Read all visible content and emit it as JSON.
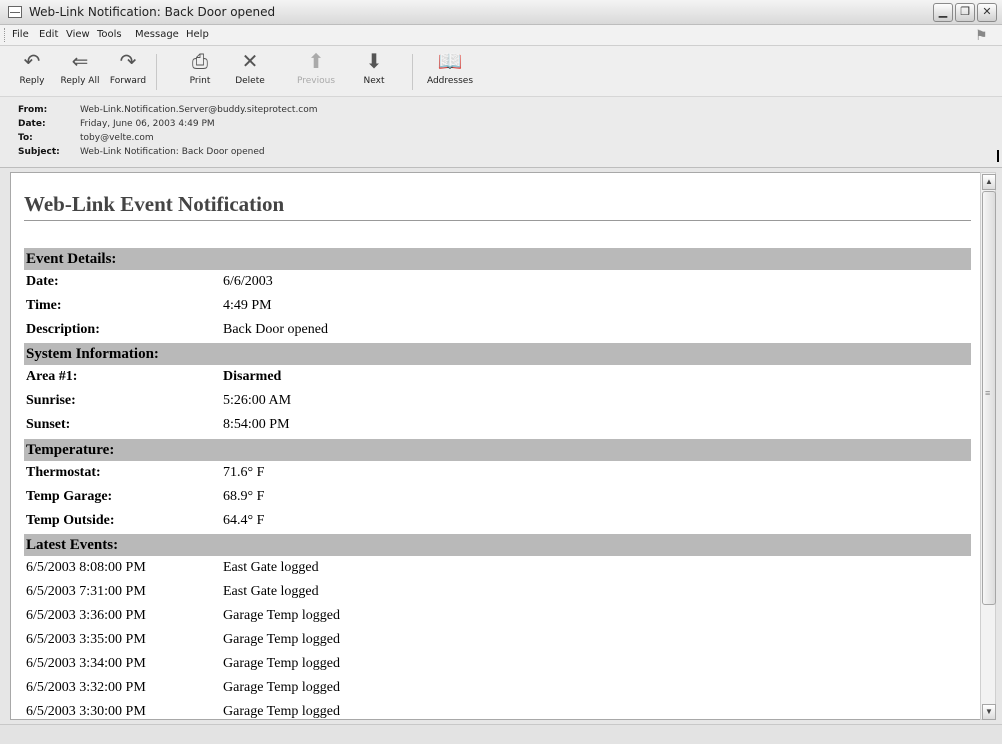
{
  "window": {
    "title": "Web-Link Notification: Back Door opened"
  },
  "menu": [
    "File",
    "Edit",
    "View",
    "Tools",
    "Message",
    "Help"
  ],
  "toolbar": {
    "reply": "Reply",
    "reply_all": "Reply All",
    "forward": "Forward",
    "print": "Print",
    "delete": "Delete",
    "previous": "Previous",
    "next": "Next",
    "addresses": "Addresses"
  },
  "header": {
    "from_label": "From:",
    "from": "Web-Link.Notification.Server@buddy.siteprotect.com",
    "date_label": "Date:",
    "date": "Friday, June 06, 2003 4:49 PM",
    "to_label": "To:",
    "to": "toby@velte.com",
    "subject_label": "Subject:",
    "subject": "Web-Link Notification: Back Door opened"
  },
  "message": {
    "title": "Web-Link Event Notification",
    "event_details": {
      "heading": "Event Details:",
      "rows": [
        {
          "k": "Date:",
          "v": "6/6/2003"
        },
        {
          "k": "Time:",
          "v": "4:49 PM"
        },
        {
          "k": "Description:",
          "v": "Back Door opened"
        }
      ]
    },
    "system_info": {
      "heading": "System Information:",
      "rows": [
        {
          "k": "Area #1:",
          "v": "Disarmed"
        },
        {
          "k": "Sunrise:",
          "v": "5:26:00 AM"
        },
        {
          "k": "Sunset:",
          "v": "8:54:00 PM"
        }
      ]
    },
    "temperature": {
      "heading": "Temperature:",
      "rows": [
        {
          "k": "Thermostat:",
          "v": "71.6° F"
        },
        {
          "k": "Temp Garage:",
          "v": "68.9° F"
        },
        {
          "k": "Temp Outside:",
          "v": "64.4° F"
        }
      ]
    },
    "latest_events": {
      "heading": "Latest Events:",
      "rows": [
        {
          "k": "6/5/2003 8:08:00 PM",
          "v": "East Gate logged"
        },
        {
          "k": "6/5/2003 7:31:00 PM",
          "v": "East Gate logged"
        },
        {
          "k": "6/5/2003 3:36:00 PM",
          "v": "Garage Temp logged"
        },
        {
          "k": "6/5/2003 3:35:00 PM",
          "v": "Garage Temp logged"
        },
        {
          "k": "6/5/2003 3:34:00 PM",
          "v": "Garage Temp logged"
        },
        {
          "k": "6/5/2003 3:32:00 PM",
          "v": "Garage Temp logged"
        },
        {
          "k": "6/5/2003 3:30:00 PM",
          "v": "Garage Temp logged"
        }
      ]
    }
  }
}
